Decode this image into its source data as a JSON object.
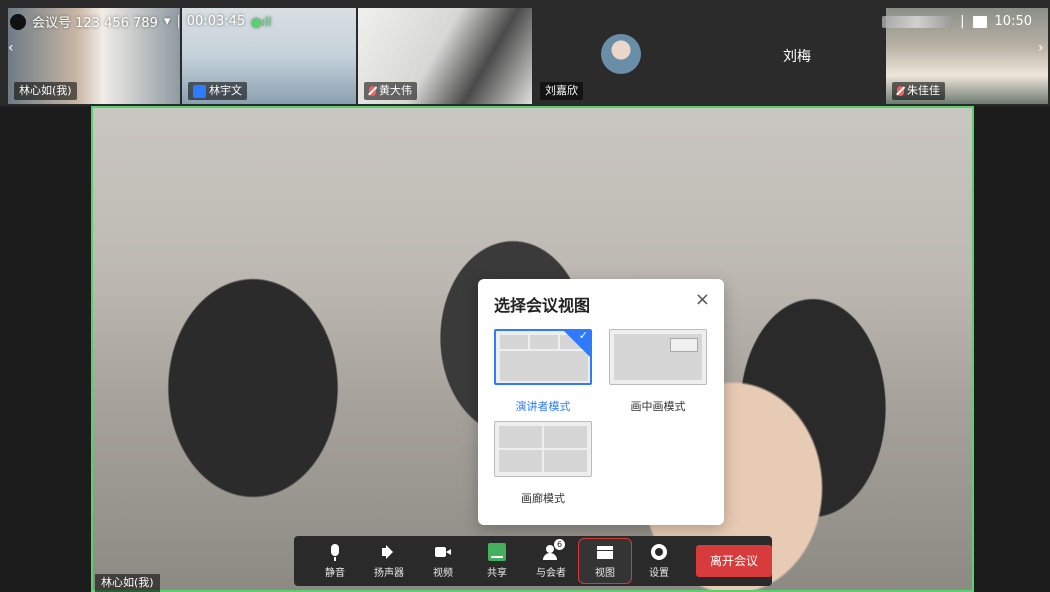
{
  "top_bar": {
    "meeting_id_label": "会议号 123 456 789",
    "meeting_dropdown": "▾",
    "separator": "|",
    "elapsed": "00:03:45",
    "signal": "●ıll",
    "time": "10:50",
    "separator_right": "|"
  },
  "participants": [
    {
      "name": "林心如(我)",
      "active": true
    },
    {
      "name": "林宇文",
      "host": true
    },
    {
      "name": "黄大伟",
      "muted": true
    },
    {
      "name": "刘嘉欣"
    },
    {
      "name": "刘梅"
    },
    {
      "name": "朱佳佳",
      "muted": true
    }
  ],
  "main_video": {
    "speaker_name": "林心如(我)"
  },
  "dialog": {
    "title": "选择会议视图",
    "close": "×",
    "options": [
      {
        "label": "演讲者模式",
        "selected": true
      },
      {
        "label": "画中画模式",
        "selected": false
      },
      {
        "label": "画廊模式",
        "selected": false
      }
    ],
    "check": "✓"
  },
  "toolbar": {
    "mute": "静音",
    "speaker": "扬声器",
    "video": "视频",
    "share": "共享",
    "participants": "与会者",
    "participants_badge": "6",
    "view": "视图",
    "settings": "设置",
    "leave": "离开会议"
  },
  "nav": {
    "left": "‹",
    "right": "›"
  },
  "colors": {
    "accent_blue": "#2f7bff",
    "active_green": "#5ad170",
    "leave_red": "#d83b3b",
    "highlight_red": "#d43a3a"
  }
}
